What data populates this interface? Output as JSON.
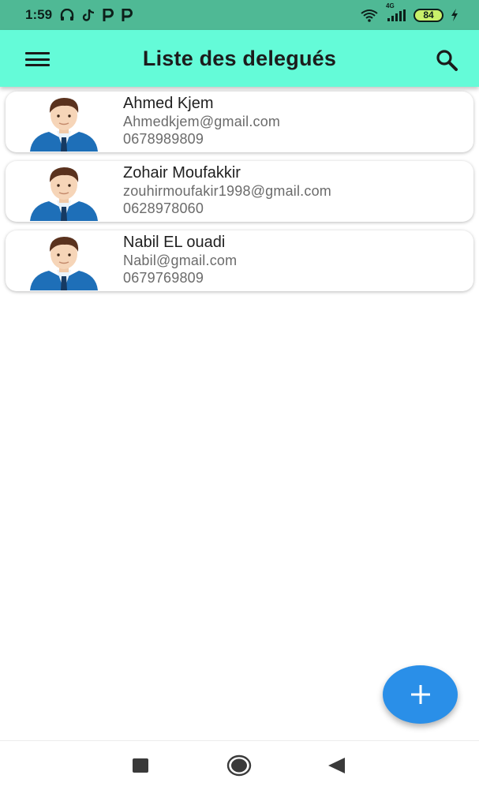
{
  "status_bar": {
    "time": "1:59",
    "network": "4G",
    "battery": "84",
    "icons": [
      "headphones-icon",
      "tiktok-icon",
      "p-app-icon",
      "p-app-icon",
      "wifi-icon",
      "signal-icon",
      "charging-bolt-icon"
    ]
  },
  "app_bar": {
    "title": "Liste des delegués",
    "menu_icon": "hamburger-menu-icon",
    "search_icon": "search-icon",
    "background": "#64fbd8"
  },
  "delegates": [
    {
      "name": "Ahmed Kjem",
      "email": "Ahmedkjem@gmail.com",
      "phone": "0678989809"
    },
    {
      "name": "Zohair Moufakkir",
      "email": "zouhirmoufakir1998@gmail.com",
      "phone": "0628978060"
    },
    {
      "name": "Nabil EL ouadi",
      "email": "Nabil@gmail.com",
      "phone": "0679769809"
    }
  ],
  "fab": {
    "icon": "plus-icon",
    "color": "#2a8fe8"
  },
  "nav_bar": {
    "icons": [
      "recents-square-icon",
      "home-circle-icon",
      "back-triangle-icon"
    ]
  }
}
